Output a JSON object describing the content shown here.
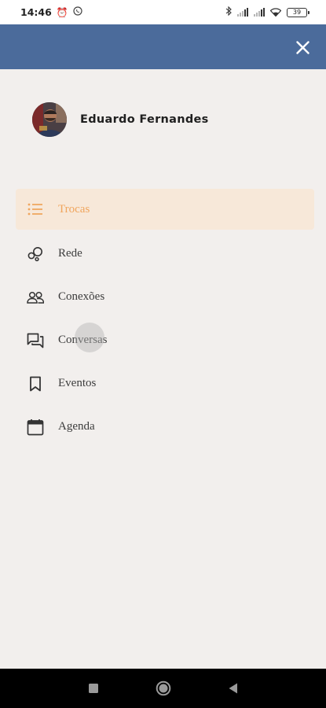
{
  "status_bar": {
    "time": "14:46",
    "battery": "39",
    "icons": [
      "alarm-icon",
      "whatsapp-icon",
      "bluetooth-icon",
      "signal-icon",
      "signal-icon",
      "wifi-icon",
      "battery-icon"
    ]
  },
  "header": {
    "color": "#4b6b9b",
    "close_icon": "close-icon"
  },
  "profile": {
    "name": "Eduardo Fernandes"
  },
  "menu": {
    "items": [
      {
        "label": "Trocas",
        "icon": "list-icon",
        "active": true
      },
      {
        "label": "Rede",
        "icon": "network-icon",
        "active": false
      },
      {
        "label": "Conexões",
        "icon": "people-icon",
        "active": false
      },
      {
        "label": "Conversas",
        "icon": "chat-icon",
        "active": false
      },
      {
        "label": "Eventos",
        "icon": "bookmark-icon",
        "active": false
      },
      {
        "label": "Agenda",
        "icon": "calendar-icon",
        "active": false
      }
    ]
  },
  "nav_bar": {
    "buttons": [
      "recents-button",
      "home-button",
      "back-button"
    ]
  },
  "colors": {
    "accent": "#f0a55d",
    "active_bg": "#f7e8d9",
    "background": "#f2efed"
  }
}
